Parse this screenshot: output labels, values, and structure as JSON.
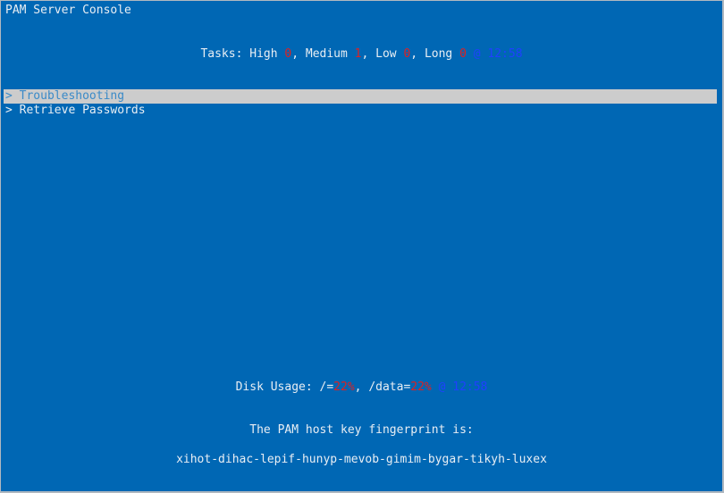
{
  "window": {
    "title": "PAM Server Console"
  },
  "tasks": {
    "label": "Tasks:",
    "high_label": "High",
    "high": "0",
    "medium_label": "Medium",
    "medium": "1",
    "low_label": "Low",
    "low": "0",
    "long_label": "Long",
    "long": "0",
    "at": "@",
    "time": "12:58"
  },
  "menu": {
    "items": [
      {
        "marker": ">",
        "label": "Troubleshooting",
        "selected": true
      },
      {
        "marker": ">",
        "label": "Retrieve Passwords",
        "selected": false
      }
    ]
  },
  "disk": {
    "label": "Disk Usage:",
    "root_label": "/=",
    "root": "22%",
    "data_label": "/data=",
    "data": "22%",
    "at": "@",
    "time": "12:58"
  },
  "fingerprint": {
    "label": "The PAM host key fingerprint is:",
    "value": "xihot-dihac-lepif-hunyp-mevob-gimim-bygar-tikyh-luxex"
  },
  "colors": {
    "background": "#0067b4",
    "text": "#e8eef4",
    "alert": "#e02020",
    "time": "#2040ff",
    "selection": "#cccccc"
  }
}
